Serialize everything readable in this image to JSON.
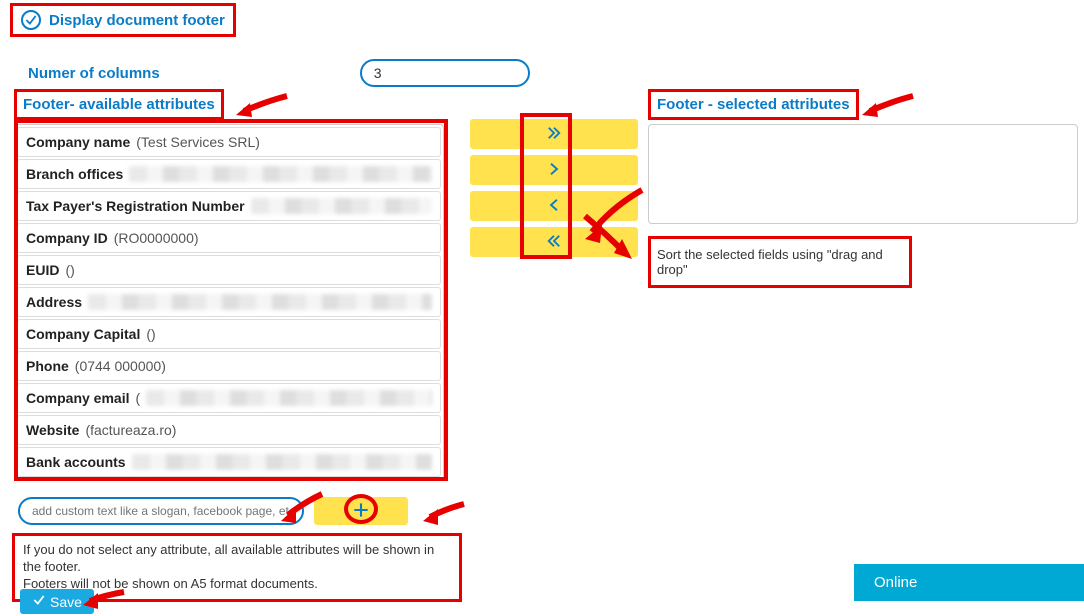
{
  "header": {
    "display_footer_label": "Display document footer",
    "num_columns_label": "Numer of columns",
    "num_columns_value": "3"
  },
  "available": {
    "title": "Footer- available attributes",
    "items": [
      {
        "label": "Company name",
        "value": "(Test Services SRL)",
        "blur": false
      },
      {
        "label": "Branch offices",
        "value": "",
        "blur": true
      },
      {
        "label": "Tax Payer's Registration Number",
        "value": "",
        "blur": true
      },
      {
        "label": "Company ID",
        "value": "(RO0000000)",
        "blur": false
      },
      {
        "label": "EUID",
        "value": "()",
        "blur": false
      },
      {
        "label": "Address",
        "value": "",
        "blur": true
      },
      {
        "label": "Company Capital",
        "value": "()",
        "blur": false
      },
      {
        "label": "Phone",
        "value": "(0744 000000)",
        "blur": false
      },
      {
        "label": "Company email",
        "value": "(",
        "blur": true
      },
      {
        "label": "Website",
        "value": "(factureaza.ro)",
        "blur": false
      },
      {
        "label": "Bank accounts",
        "value": "",
        "blur": true
      }
    ]
  },
  "selected": {
    "title": "Footer - selected attributes",
    "hint": "Sort the selected fields using \"drag and drop\""
  },
  "custom": {
    "placeholder": "add custom text like a slogan, facebook page, etc."
  },
  "note": {
    "line1": "If you do not select any attribute, all available attributes will be shown in the footer.",
    "line2": "Footers will not be shown on A5 format documents."
  },
  "buttons": {
    "save": "Save"
  },
  "status": {
    "online": "Online"
  }
}
